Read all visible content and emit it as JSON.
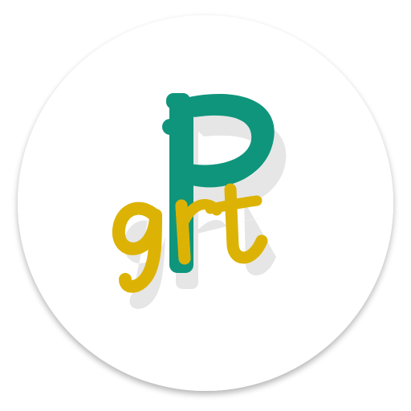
{
  "app_icon": {
    "logo_text": "Pgrt",
    "icon_name": "pgrt-app-icon",
    "colors": {
      "background_circle": "#ffffff",
      "letter_p": "#0f957c",
      "letters_grt": "#dcb304",
      "shadow": "#e6e6e6"
    }
  }
}
